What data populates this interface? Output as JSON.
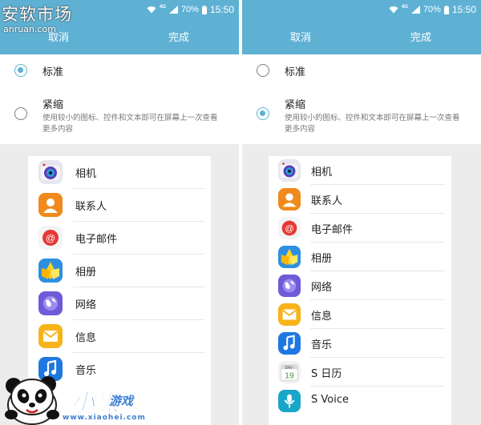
{
  "status_bar": {
    "network": "4G",
    "battery": "70%",
    "time": "15:50"
  },
  "header": {
    "cancel": "取消",
    "done": "完成"
  },
  "options": {
    "standard_title": "标准",
    "compact_title": "紧缩",
    "compact_desc": "使用较小的图标、控件和文本即可在屏幕上一次查看更多内容"
  },
  "left_panel": {
    "selected": "standard",
    "apps": [
      {
        "icon": "camera-icon",
        "label": "相机"
      },
      {
        "icon": "contacts-icon",
        "label": "联系人"
      },
      {
        "icon": "email-icon",
        "label": "电子邮件"
      },
      {
        "icon": "gallery-icon",
        "label": "相册"
      },
      {
        "icon": "internet-icon",
        "label": "网络"
      },
      {
        "icon": "messages-icon",
        "label": "信息"
      },
      {
        "icon": "music-icon",
        "label": "音乐"
      }
    ]
  },
  "right_panel": {
    "selected": "compact",
    "apps": [
      {
        "icon": "camera-icon",
        "label": "相机"
      },
      {
        "icon": "contacts-icon",
        "label": "联系人"
      },
      {
        "icon": "email-icon",
        "label": "电子邮件"
      },
      {
        "icon": "gallery-icon",
        "label": "相册"
      },
      {
        "icon": "internet-icon",
        "label": "网络"
      },
      {
        "icon": "messages-icon",
        "label": "信息"
      },
      {
        "icon": "music-icon",
        "label": "音乐"
      },
      {
        "icon": "calendar-icon",
        "label": "S 日历",
        "calendar_day": "19",
        "calendar_weekday": "星期六"
      },
      {
        "icon": "svoice-icon",
        "label": "S Voice"
      }
    ]
  },
  "watermarks": {
    "top_cn": "安软市场",
    "top_en": "anruan.com",
    "bottom_brand": "小黑",
    "bottom_brand_sub": "游戏",
    "bottom_url": "www.xiaohei.com"
  },
  "colors": {
    "accent": "#5fb1d4",
    "background": "#ececec",
    "card": "#ffffff"
  }
}
